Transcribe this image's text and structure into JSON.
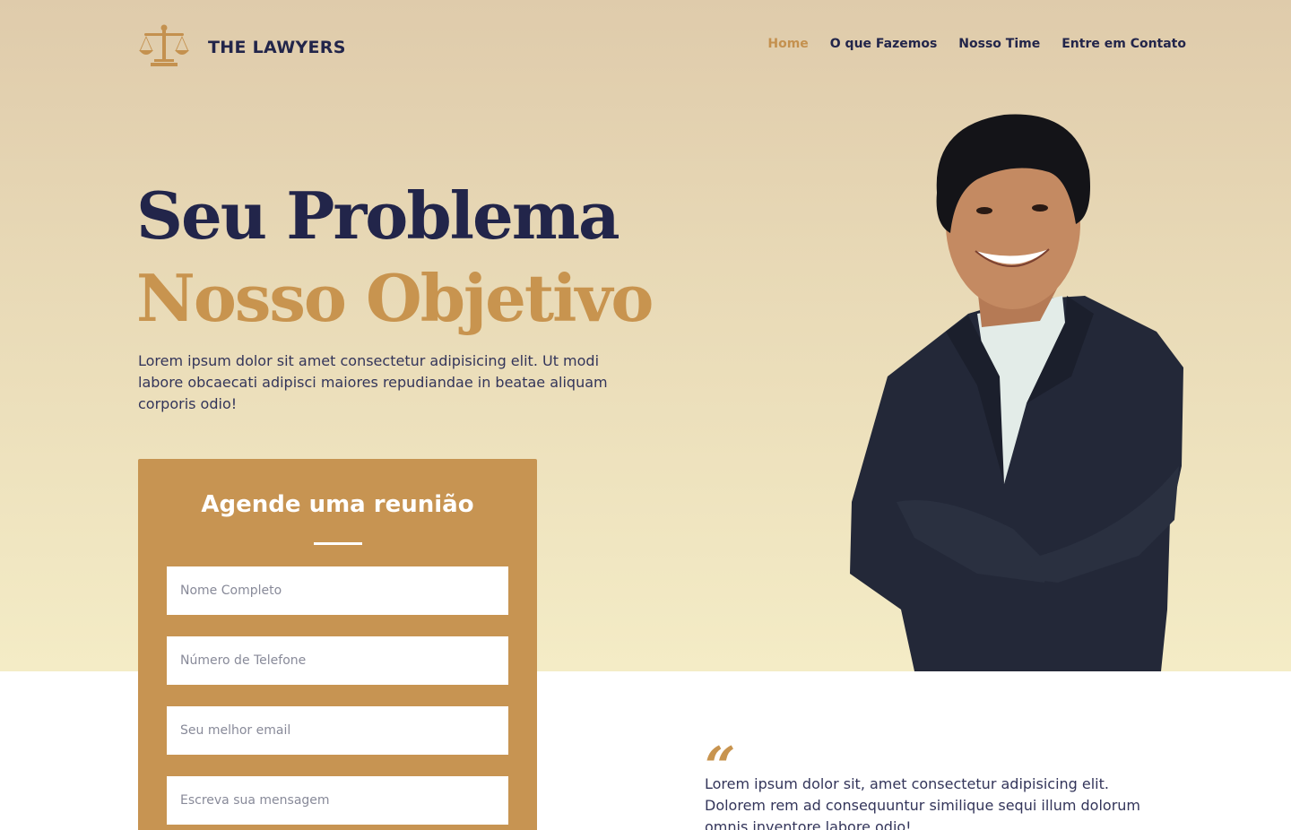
{
  "brand": {
    "name": "THE LAWYERS"
  },
  "nav": {
    "items": [
      {
        "label": "Home",
        "active": true
      },
      {
        "label": "O que Fazemos",
        "active": false
      },
      {
        "label": "Nosso Time",
        "active": false
      },
      {
        "label": "Entre em Contato",
        "active": false
      }
    ]
  },
  "hero": {
    "title_line1": "Seu Problema",
    "title_line2": "Nosso Objetivo",
    "description": "Lorem ipsum dolor sit amet consectetur adipisicing elit. Ut modi labore obcaecati adipisci maiores repudiandae in beatae aliquam corporis odio!"
  },
  "form": {
    "title": "Agende uma reunião",
    "fields": {
      "name_placeholder": "Nome Completo",
      "phone_placeholder": "Número de Telefone",
      "email_placeholder": "Seu melhor email",
      "message_placeholder": "Escreva sua mensagem"
    }
  },
  "testimonial": {
    "quote_mark": "“",
    "text": "Lorem ipsum dolor sit, amet consectetur adipisicing elit. Dolorem rem ad consequuntur similique sequi illum dolorum omnis inventore labore odio!"
  },
  "colors": {
    "primary": "#22254a",
    "accent": "#c8944f",
    "hero_top": "#dfcbab",
    "hero_bottom": "#f4ecc6"
  }
}
